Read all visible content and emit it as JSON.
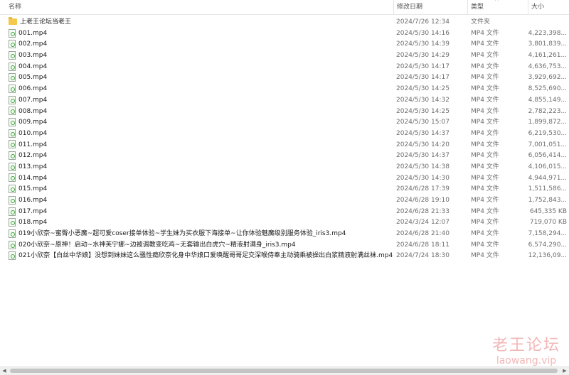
{
  "columns": {
    "name": "名称",
    "date": "修改日期",
    "type": "类型",
    "size": "大小"
  },
  "files": [
    {
      "name": "上老王论坛当老王",
      "date": "2024/7/26 12:34",
      "type": "文件夹",
      "size": "",
      "kind": "folder"
    },
    {
      "name": "001.mp4",
      "date": "2024/5/30 14:16",
      "type": "MP4 文件",
      "size": "4,223,398...",
      "kind": "file"
    },
    {
      "name": "002.mp4",
      "date": "2024/5/30 14:39",
      "type": "MP4 文件",
      "size": "3,801,839...",
      "kind": "file"
    },
    {
      "name": "003.mp4",
      "date": "2024/5/30 14:29",
      "type": "MP4 文件",
      "size": "4,161,261...",
      "kind": "file"
    },
    {
      "name": "004.mp4",
      "date": "2024/5/30 14:17",
      "type": "MP4 文件",
      "size": "4,636,753...",
      "kind": "file"
    },
    {
      "name": "005.mp4",
      "date": "2024/5/30 14:17",
      "type": "MP4 文件",
      "size": "3,929,692...",
      "kind": "file"
    },
    {
      "name": "006.mp4",
      "date": "2024/5/30 14:25",
      "type": "MP4 文件",
      "size": "8,525,690...",
      "kind": "file"
    },
    {
      "name": "007.mp4",
      "date": "2024/5/30 14:32",
      "type": "MP4 文件",
      "size": "4,855,149...",
      "kind": "file"
    },
    {
      "name": "008.mp4",
      "date": "2024/5/30 14:25",
      "type": "MP4 文件",
      "size": "2,782,223...",
      "kind": "file"
    },
    {
      "name": "009.mp4",
      "date": "2024/5/30 15:07",
      "type": "MP4 文件",
      "size": "1,899,872...",
      "kind": "file"
    },
    {
      "name": "010.mp4",
      "date": "2024/5/30 14:37",
      "type": "MP4 文件",
      "size": "6,219,530...",
      "kind": "file"
    },
    {
      "name": "011.mp4",
      "date": "2024/5/30 14:20",
      "type": "MP4 文件",
      "size": "7,001,051...",
      "kind": "file"
    },
    {
      "name": "012.mp4",
      "date": "2024/5/30 14:37",
      "type": "MP4 文件",
      "size": "6,056,414...",
      "kind": "file"
    },
    {
      "name": "013.mp4",
      "date": "2024/5/30 14:38",
      "type": "MP4 文件",
      "size": "4,106,015...",
      "kind": "file"
    },
    {
      "name": "014.mp4",
      "date": "2024/5/30 14:30",
      "type": "MP4 文件",
      "size": "4,944,971...",
      "kind": "file"
    },
    {
      "name": "015.mp4",
      "date": "2024/6/28 17:39",
      "type": "MP4 文件",
      "size": "1,511,586...",
      "kind": "file"
    },
    {
      "name": "016.mp4",
      "date": "2024/6/28 19:10",
      "type": "MP4 文件",
      "size": "1,752,843...",
      "kind": "file"
    },
    {
      "name": "017.mp4",
      "date": "2024/6/28 21:33",
      "type": "MP4 文件",
      "size": "645,335 KB",
      "kind": "file"
    },
    {
      "name": "018.mp4",
      "date": "2024/3/24 12:07",
      "type": "MP4 文件",
      "size": "719,070 KB",
      "kind": "file"
    },
    {
      "name": "019小欣奈~蜜臀小恶魔~超可爱coser接单体验~学生妹为买衣服下海接单~让你体验魅魔级别服务体验_iris3.mp4",
      "date": "2024/6/28 21:40",
      "type": "MP4 文件",
      "size": "7,158,294...",
      "kind": "file"
    },
    {
      "name": "020小欣奈~原神！启动~水神芙宁娜~边被调教变吃鸡~无套输出白虎穴~精液射满身_iris3.mp4",
      "date": "2024/6/28 18:11",
      "type": "MP4 文件",
      "size": "6,574,290...",
      "kind": "file"
    },
    {
      "name": "021小欣奈【白丝中华娘】没想到妹妹这么骚性瘾欣奈化身中华娘口爱唤醒哥哥足交深喉侍奉主动骑乘被操出白浆精液射满丝袜.mp4",
      "date": "2024/7/24 18:30",
      "type": "MP4 文件",
      "size": "12,136,09...",
      "kind": "file"
    }
  ],
  "watermark": {
    "cn": "老王论坛",
    "en": "laowang.vip"
  },
  "scrollbar": {
    "left_arrow": "◀",
    "right_arrow": "▶",
    "sort_arrow": "^"
  }
}
